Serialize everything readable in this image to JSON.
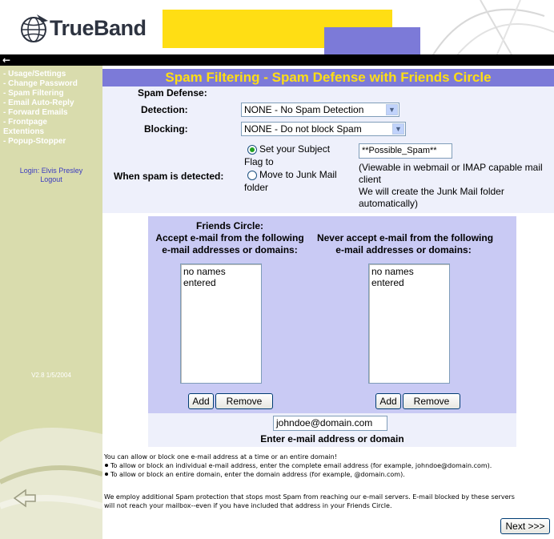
{
  "header": {
    "logo_text": "TrueBand",
    "back_arrow": "←"
  },
  "sidebar": {
    "items": [
      {
        "label": "- Usage/Settings"
      },
      {
        "label": "- Change Password"
      },
      {
        "label": "- Spam Filtering"
      },
      {
        "label": "- Email Auto-Reply"
      },
      {
        "label": "- Forward Emails"
      },
      {
        "label": "- Frontpage"
      },
      {
        "label": "Extentions"
      },
      {
        "label": "- Popup-Stopper"
      }
    ],
    "login_text": "Login: Elvis Presley",
    "logout_label": "Logout",
    "version": "V2.8 1/5/2004"
  },
  "main": {
    "title": "Spam Filtering - Spam Defense with Friends Circle",
    "spam_defense_label": "Spam Defense:",
    "detection_label": "Detection:",
    "detection_value": "NONE - No Spam Detection",
    "blocking_label": "Blocking:",
    "blocking_value": "NONE - Do not block Spam",
    "when_detected_label": "When spam is detected:",
    "option_subject_line1": "Set your Subject",
    "option_subject_line2": "Flag to",
    "option_junk_line1": "Move to Junk Mail",
    "option_junk_line2": "folder",
    "subject_flag_value": "**Possible_Spam**",
    "info_line1": "(Viewable in webmail or IMAP capable mail",
    "info_line2": "client",
    "info_line3": "We will create the Junk Mail folder",
    "info_line4": "automatically)"
  },
  "friends_panel": {
    "heading_line1": "Friends Circle:",
    "heading_line2": "Accept e-mail from the following",
    "heading_line3": "e-mail addresses or domains:",
    "list_placeholder": "no names entered",
    "add_label": "Add",
    "remove_label": "Remove"
  },
  "block_panel": {
    "heading_line1": "Never accept e-mail from the following",
    "heading_line2": "e-mail addresses or domains:",
    "list_placeholder": "no names entered",
    "add_label": "Add",
    "remove_label": "Remove"
  },
  "entry": {
    "value": "johndoe@domain.com",
    "label": "Enter e-mail address or domain"
  },
  "help": {
    "intro": "You can allow or block one e-mail address at a time or an entire domain!",
    "bullet1": "To allow or block an individual e-mail address, enter the complete email address (for example, johndoe@domain.com).",
    "bullet2": "To allow or block an entire domain, enter the domain address (for example, @domain.com).",
    "note_line1": "We employ additional Spam protection that stops most Spam from reaching our e-mail servers. E-mail blocked by these servers",
    "note_line2": "will not reach your mailbox--even if you have included that address in your Friends Circle."
  },
  "footer": {
    "next_label": "Next >>>"
  },
  "colors": {
    "yellow": "#ffde14",
    "periwinkle": "#7c7ad8",
    "sidebar": "#d9dcad",
    "panel_bg": "#c9caf4"
  }
}
